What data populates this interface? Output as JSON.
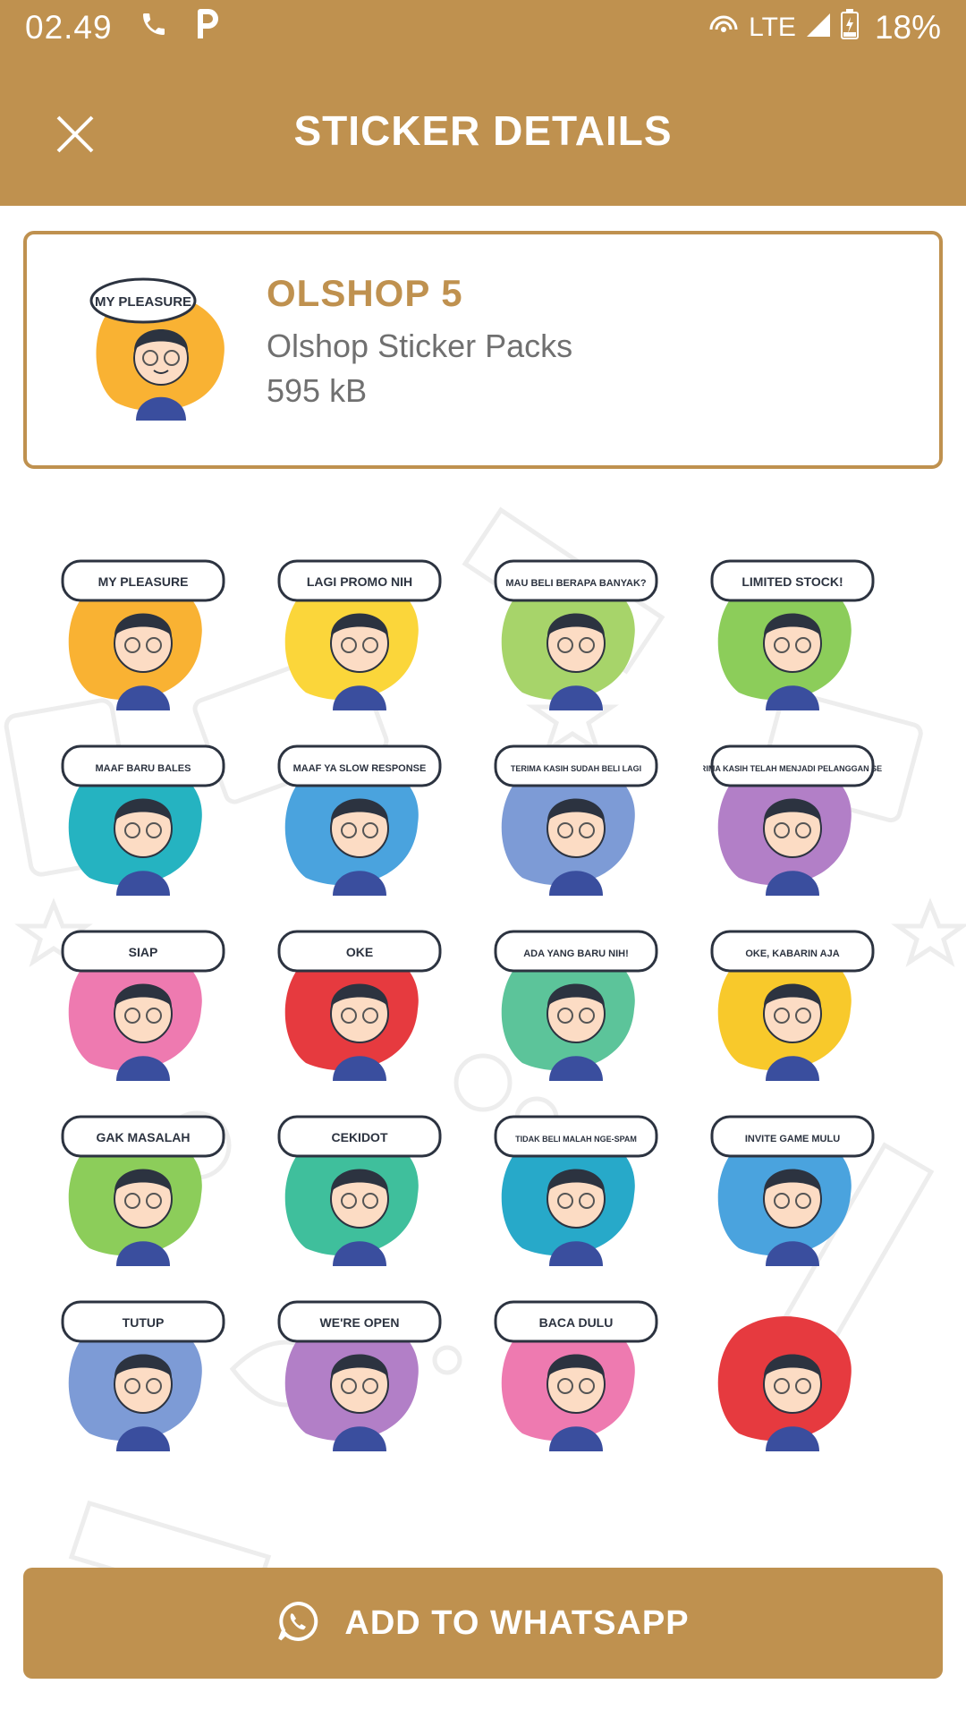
{
  "status_bar": {
    "time": "02.49",
    "network": "LTE",
    "battery": "18%"
  },
  "app_bar": {
    "title": "STICKER DETAILS"
  },
  "pack": {
    "name": "OLSHOP 5",
    "author": "Olshop Sticker Packs",
    "size": "595 kB",
    "tray_caption": "MY PLEASURE"
  },
  "stickers": [
    {
      "caption": "MY PLEASURE",
      "color": "#f9b233"
    },
    {
      "caption": "LAGI PROMO NIH",
      "color": "#fbd63a"
    },
    {
      "caption": "MAU BELI BERAPA BANYAK?",
      "color": "#a7d46a"
    },
    {
      "caption": "LIMITED STOCK!",
      "color": "#8ccd5a"
    },
    {
      "caption": "MAAF BARU BALES",
      "color": "#25b3c1"
    },
    {
      "caption": "MAAF YA SLOW RESPONSE",
      "color": "#4aa3de"
    },
    {
      "caption": "TERIMA KASIH SUDAH BELI LAGI",
      "color": "#7d9bd6"
    },
    {
      "caption": "TERIMA KASIH TELAH MENJADI PELANGGAN SETIA",
      "color": "#b27fc7"
    },
    {
      "caption": "SIAP",
      "color": "#ee7ab0"
    },
    {
      "caption": "OKE",
      "color": "#e63a3f"
    },
    {
      "caption": "ADA YANG BARU NIH!",
      "color": "#5cc49a"
    },
    {
      "caption": "OKE, KABARIN AJA",
      "color": "#f8c92b"
    },
    {
      "caption": "GAK MASALAH",
      "color": "#8ccd5a"
    },
    {
      "caption": "CEKIDOT",
      "color": "#3fbf9c"
    },
    {
      "caption": "TIDAK BELI MALAH NGE-SPAM",
      "color": "#27a9c9"
    },
    {
      "caption": "INVITE GAME MULU",
      "color": "#4aa3de"
    },
    {
      "caption": "TUTUP",
      "color": "#7d9bd6"
    },
    {
      "caption": "WE'RE OPEN",
      "color": "#b27fc7"
    },
    {
      "caption": "BACA DULU",
      "color": "#ee7ab0"
    },
    {
      "caption": "",
      "color": "#e63a3f"
    }
  ],
  "add_button": {
    "label": "ADD TO WHATSAPP"
  },
  "colors": {
    "accent": "#bf914f",
    "text_secondary": "#707070"
  },
  "icons": [
    "phone-icon",
    "parking-icon",
    "hotspot-icon",
    "signal-icon",
    "battery-icon",
    "close-icon",
    "whatsapp-icon"
  ]
}
